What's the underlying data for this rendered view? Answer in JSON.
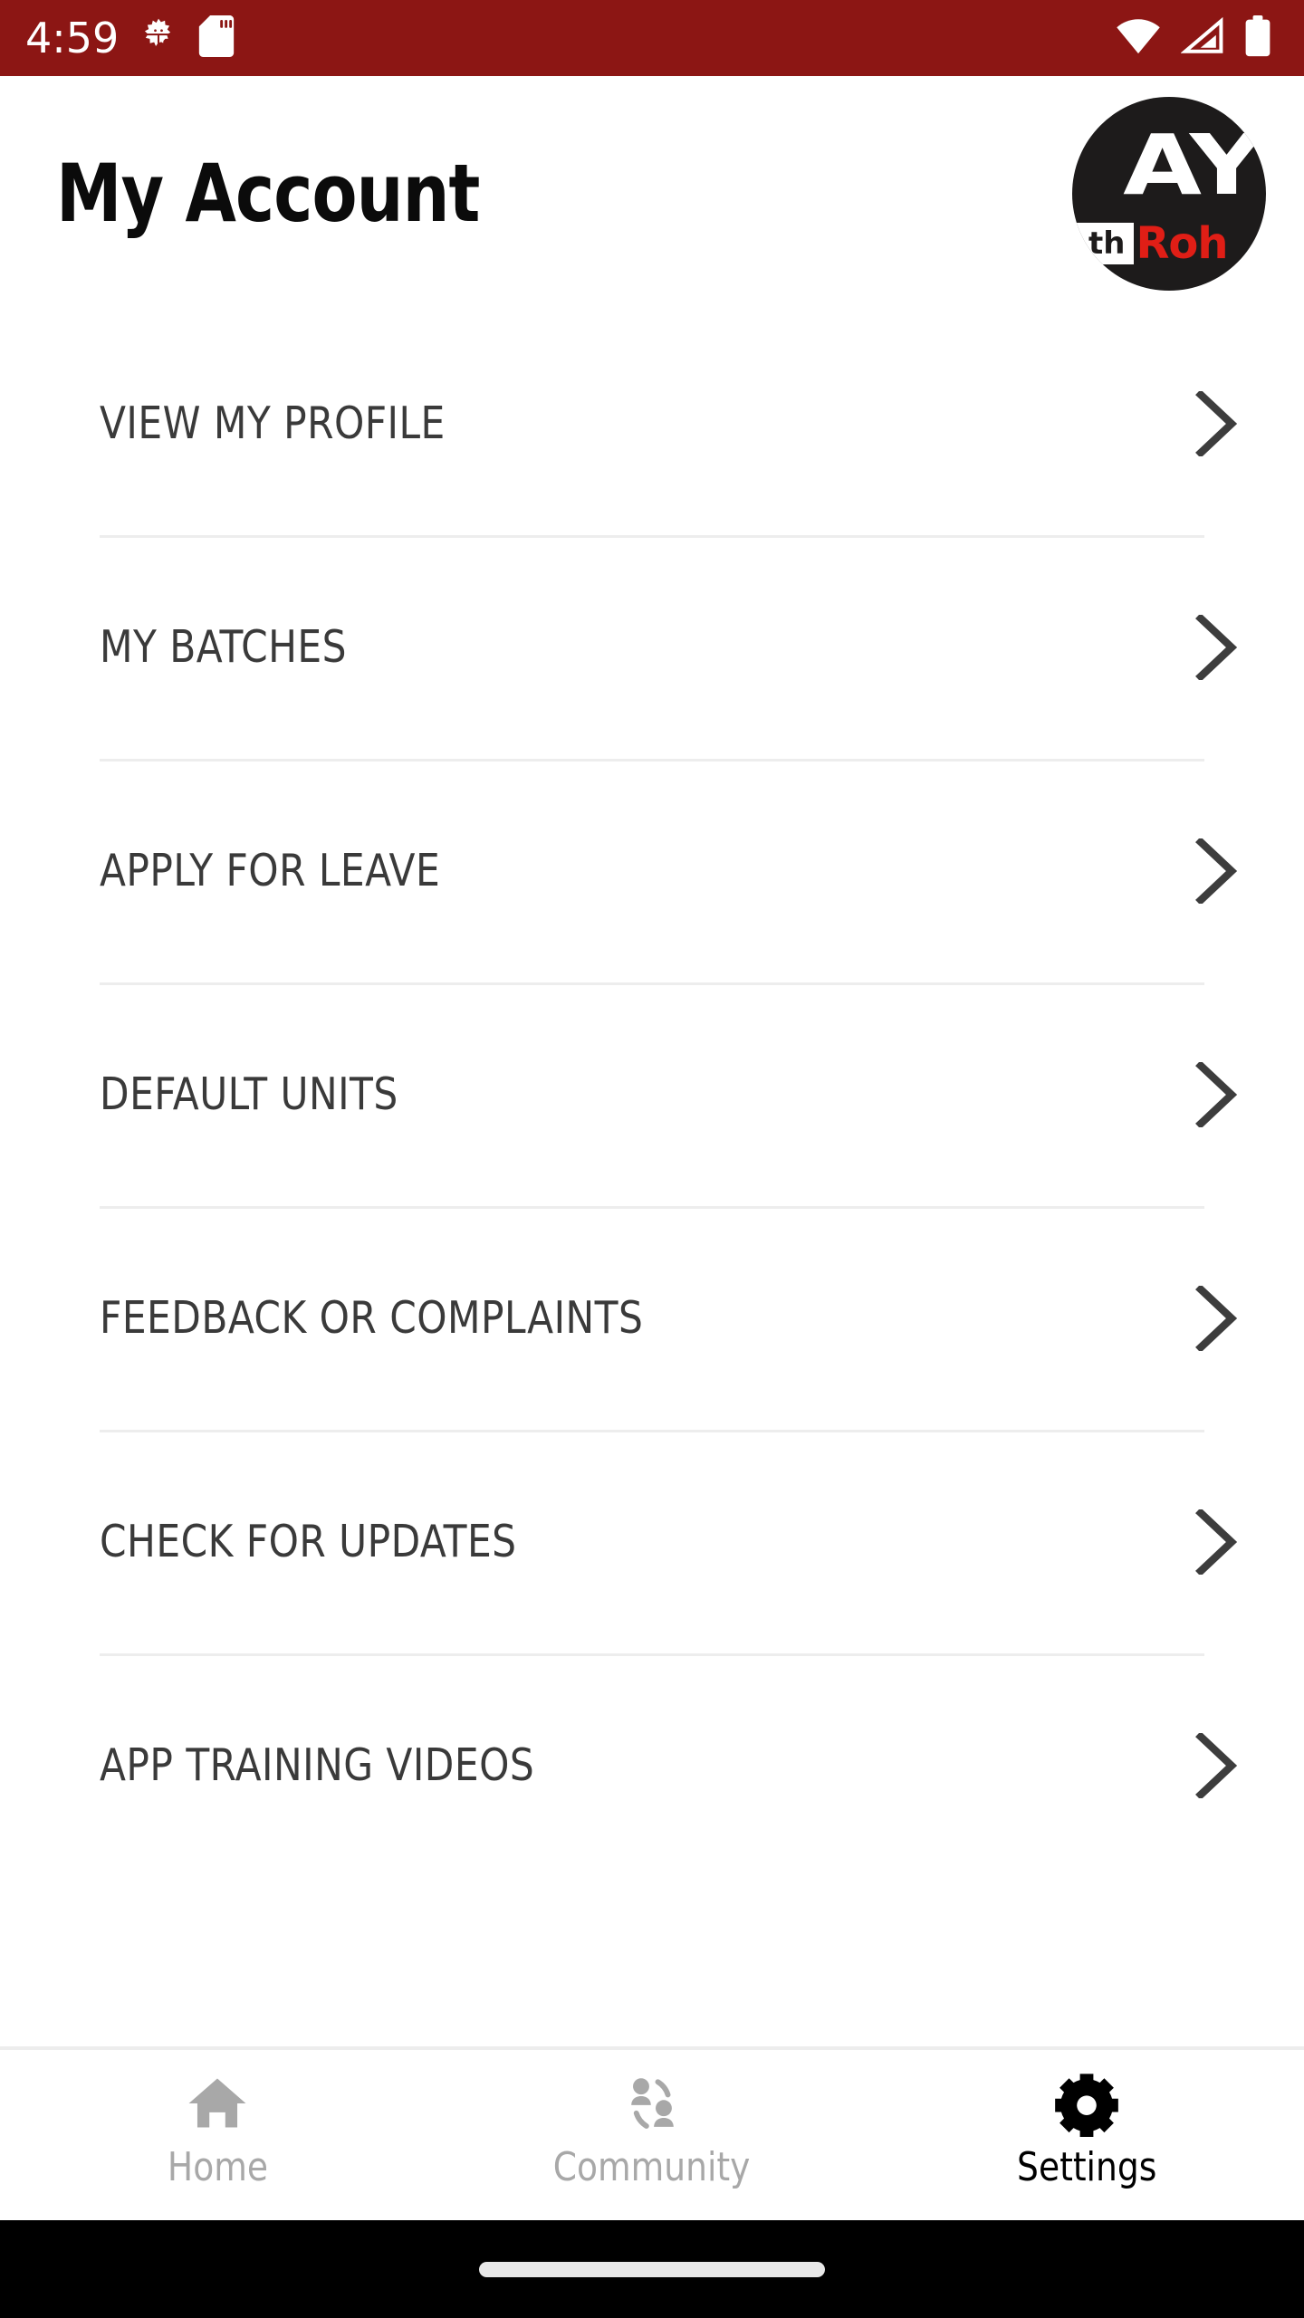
{
  "status_bar": {
    "time": "4:59",
    "background_color": "#8C1614",
    "icons": [
      "bug-debug-icon",
      "sd-card-icon",
      "wifi-icon",
      "cellular-signal-icon",
      "battery-icon"
    ]
  },
  "header": {
    "title": "My Account",
    "logo": {
      "name": "ay-roh-logo",
      "top_text": "AY",
      "badge_text": "th",
      "brand_text": "Roh",
      "circle_color": "#1d1b1b",
      "brand_color": "#E01E16"
    }
  },
  "menu": {
    "items": [
      {
        "label": "VIEW MY PROFILE",
        "name": "menu-item-view-my-profile"
      },
      {
        "label": "MY BATCHES",
        "name": "menu-item-my-batches"
      },
      {
        "label": "APPLY FOR LEAVE",
        "name": "menu-item-apply-for-leave"
      },
      {
        "label": "DEFAULT UNITS",
        "name": "menu-item-default-units"
      },
      {
        "label": "FEEDBACK OR COMPLAINTS",
        "name": "menu-item-feedback-or-complaints"
      },
      {
        "label": "CHECK FOR UPDATES",
        "name": "menu-item-check-for-updates"
      },
      {
        "label": "APP TRAINING VIDEOS",
        "name": "menu-item-app-training-videos"
      }
    ],
    "chevron_icon": "chevron-right-icon",
    "divider_color": "#EDEDED",
    "label_color": "#3a3a3a"
  },
  "bottom_nav": {
    "items": [
      {
        "label": "Home",
        "icon": "home-icon",
        "active": false,
        "color": "#A8A8A8"
      },
      {
        "label": "Community",
        "icon": "community-icon",
        "active": false,
        "color": "#A8A8A8"
      },
      {
        "label": "Settings",
        "icon": "gear-icon",
        "active": true,
        "color": "#000000"
      }
    ]
  },
  "gesture_bar": {
    "background_color": "#000000",
    "pill_color": "#E8E8E8"
  }
}
